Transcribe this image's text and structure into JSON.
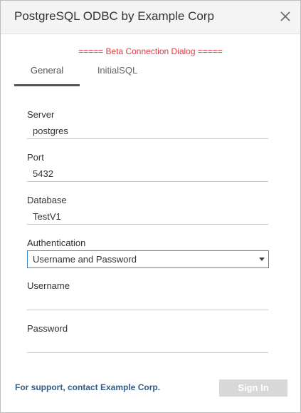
{
  "dialog": {
    "title": "PostgreSQL ODBC by Example Corp",
    "close_icon": "close-icon",
    "beta_notice": "===== Beta Connection Dialog =====",
    "beta_color": "#e03a3e"
  },
  "tabs": [
    {
      "label": "General",
      "active": true
    },
    {
      "label": "InitialSQL",
      "active": false
    }
  ],
  "fields": {
    "server": {
      "label": "Server",
      "value": "postgres"
    },
    "port": {
      "label": "Port",
      "value": "5432"
    },
    "database": {
      "label": "Database",
      "value": "TestV1"
    },
    "authentication": {
      "label": "Authentication",
      "selected": "Username and Password"
    },
    "username": {
      "label": "Username",
      "value": ""
    },
    "password": {
      "label": "Password",
      "value": ""
    }
  },
  "footer": {
    "support_link": "For support, contact Example Corp.",
    "sign_in": "Sign In",
    "support_color": "#2f5d8a"
  }
}
